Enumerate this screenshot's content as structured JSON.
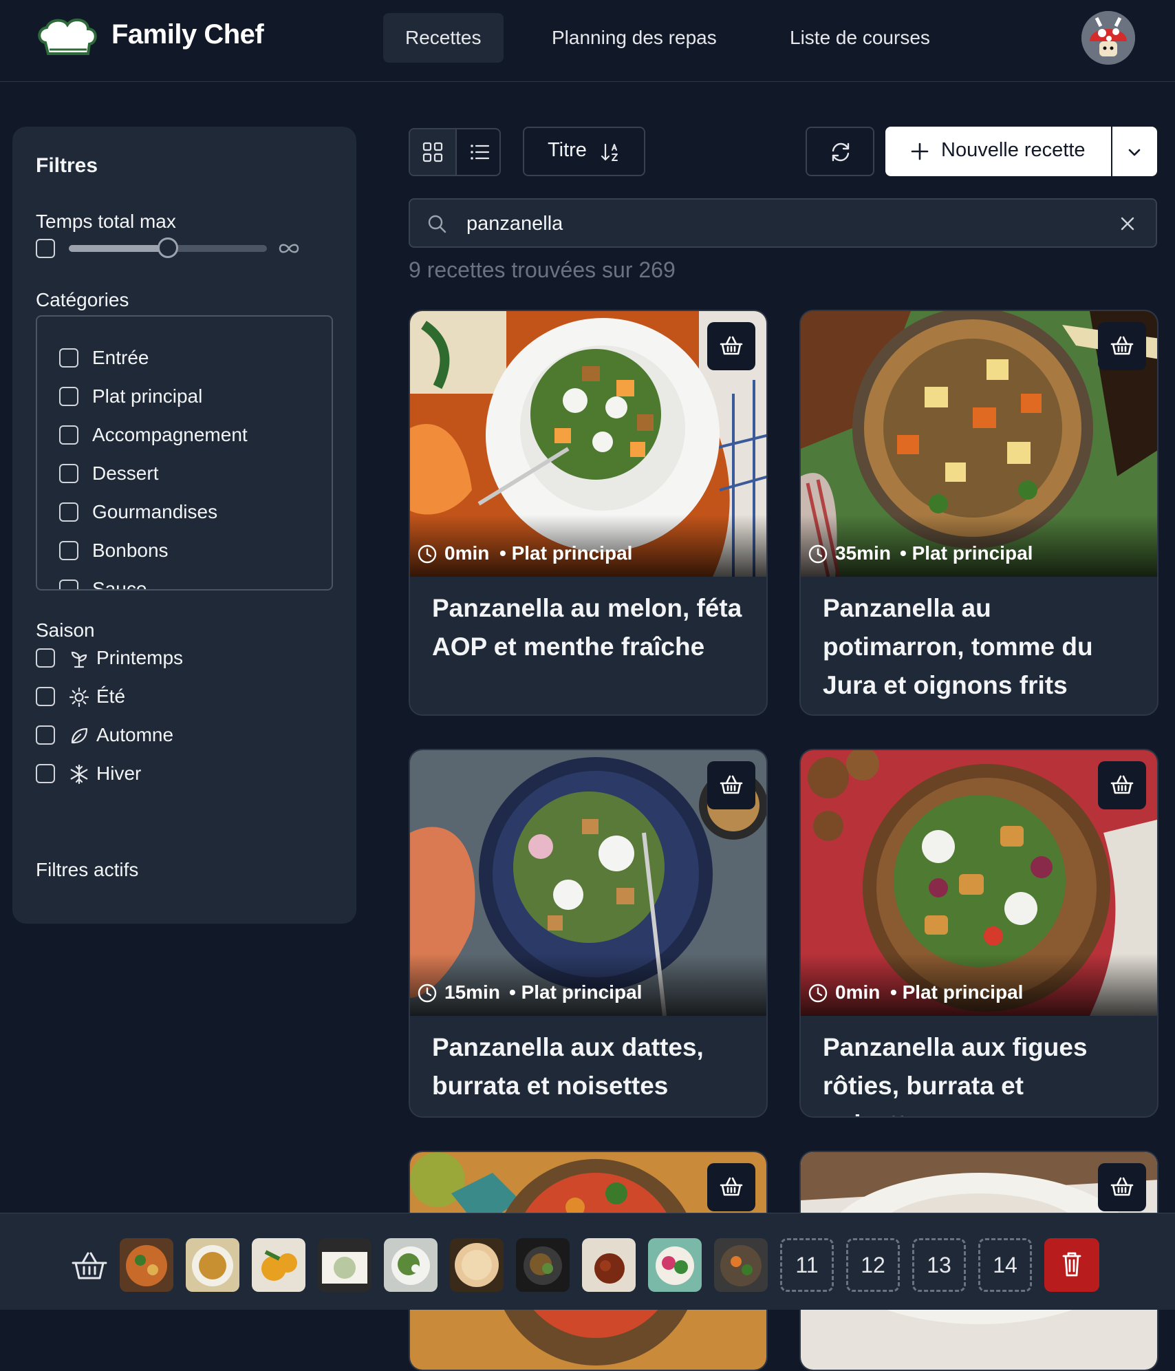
{
  "header": {
    "app_title": "Family Chef",
    "nav": [
      {
        "label": "Recettes",
        "active": true
      },
      {
        "label": "Planning des repas",
        "active": false
      },
      {
        "label": "Liste de courses",
        "active": false
      }
    ]
  },
  "sidebar": {
    "title": "Filtres",
    "time_filter": {
      "label": "Temps total max",
      "enabled": false,
      "slider_fraction": 0.5,
      "max_symbol": "∞"
    },
    "categories_label": "Catégories",
    "categories": [
      "Entrée",
      "Plat principal",
      "Accompagnement",
      "Dessert",
      "Gourmandises",
      "Bonbons",
      "Sauce"
    ],
    "season_label": "Saison",
    "seasons": [
      {
        "label": "Printemps",
        "icon": "sprout-icon"
      },
      {
        "label": "Été",
        "icon": "sun-icon"
      },
      {
        "label": "Automne",
        "icon": "leaf-icon"
      },
      {
        "label": "Hiver",
        "icon": "snowflake-icon"
      }
    ],
    "active_filters_label": "Filtres actifs"
  },
  "toolbar": {
    "view_modes": [
      "grid-icon",
      "list-icon"
    ],
    "active_view": "grid",
    "sort_label": "Titre",
    "sort_icon": "sort-ascending-icon",
    "refresh_icon": "refresh-icon",
    "new_recipe_label": "Nouvelle recette"
  },
  "search": {
    "value": "panzanella",
    "placeholder": ""
  },
  "results_text": "9 recettes trouvées sur 269",
  "recipes": [
    {
      "time": "0min",
      "category": "Plat principal",
      "title": "Panzanella au melon, féta AOP et menthe fraîche"
    },
    {
      "time": "35min",
      "category": "Plat principal",
      "title": "Panzanella au potimarron, tomme du Jura et oignons frits"
    },
    {
      "time": "15min",
      "category": "Plat principal",
      "title": "Panzanella aux dattes, burrata et noisettes"
    },
    {
      "time": "0min",
      "category": "Plat principal",
      "title": "Panzanella aux figues rôties, burrata et noisettes"
    },
    {
      "time": "",
      "category": "",
      "title": ""
    },
    {
      "time": "",
      "category": "",
      "title": ""
    }
  ],
  "meal_bar": {
    "slots_filled": 10,
    "empty_slots": [
      "11",
      "12",
      "13",
      "14"
    ]
  },
  "colors": {
    "background": "#111827",
    "panel": "#1f2937",
    "border": "#374151",
    "danger": "#b91c1c",
    "text": "#f3f4f6",
    "muted": "#6b7280"
  }
}
